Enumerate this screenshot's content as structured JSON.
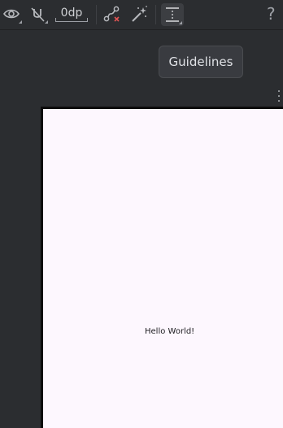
{
  "toolbar": {
    "default_margin": "0dp",
    "help": "?"
  },
  "tooltip": {
    "text": "Guidelines"
  },
  "canvas": {
    "text": "Hello World!"
  },
  "icons": [
    "eye-icon",
    "magnet-off-icon",
    "clear-constraints-icon",
    "infer-constraints-icon",
    "guidelines-icon",
    "help-icon",
    "more-options-icon"
  ]
}
